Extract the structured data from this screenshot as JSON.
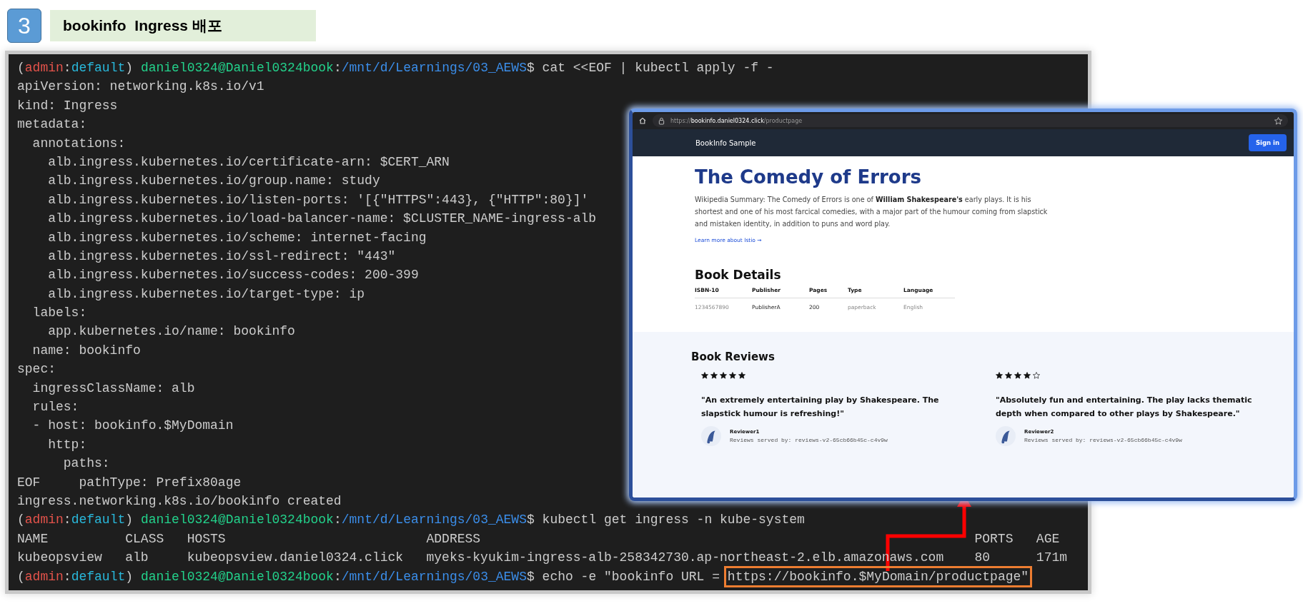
{
  "header": {
    "step": "3",
    "title": "bookinfo  Ingress 배포"
  },
  "terminal": {
    "lines": [
      {
        "kind": "segments",
        "segments": [
          {
            "text": "(",
            "color": "#cccccc"
          },
          {
            "text": "admin",
            "color": "#e5534b"
          },
          {
            "text": ":",
            "color": "#cccccc"
          },
          {
            "text": "default",
            "color": "#29b8db"
          },
          {
            "text": ") ",
            "color": "#cccccc"
          },
          {
            "text": "daniel0324@Daniel0324book",
            "color": "#23d18b"
          },
          {
            "text": ":",
            "color": "#cccccc"
          },
          {
            "text": "/mnt/d/Learnings/03_AEWS",
            "color": "#3b8eea"
          },
          {
            "text": "$ cat <<EOF | kubectl apply -f -",
            "color": "#cccccc"
          }
        ]
      },
      {
        "kind": "text",
        "text": "apiVersion: networking.k8s.io/v1"
      },
      {
        "kind": "text",
        "text": "kind: Ingress"
      },
      {
        "kind": "text",
        "text": "metadata:"
      },
      {
        "kind": "text",
        "text": "  annotations:"
      },
      {
        "kind": "text",
        "text": "    alb.ingress.kubernetes.io/certificate-arn: $CERT_ARN"
      },
      {
        "kind": "text",
        "text": "    alb.ingress.kubernetes.io/group.name: study"
      },
      {
        "kind": "text",
        "text": "    alb.ingress.kubernetes.io/listen-ports: '[{\"HTTPS\":443}, {\"HTTP\":80}]'"
      },
      {
        "kind": "text",
        "text": "    alb.ingress.kubernetes.io/load-balancer-name: $CLUSTER_NAME-ingress-alb"
      },
      {
        "kind": "text",
        "text": "    alb.ingress.kubernetes.io/scheme: internet-facing"
      },
      {
        "kind": "text",
        "text": "    alb.ingress.kubernetes.io/ssl-redirect: \"443\""
      },
      {
        "kind": "text",
        "text": "    alb.ingress.kubernetes.io/success-codes: 200-399"
      },
      {
        "kind": "text",
        "text": "    alb.ingress.kubernetes.io/target-type: ip"
      },
      {
        "kind": "text",
        "text": "  labels:"
      },
      {
        "kind": "text",
        "text": "    app.kubernetes.io/name: bookinfo"
      },
      {
        "kind": "text",
        "text": "  name: bookinfo"
      },
      {
        "kind": "text",
        "text": "spec:"
      },
      {
        "kind": "text",
        "text": "  ingressClassName: alb"
      },
      {
        "kind": "text",
        "text": "  rules:"
      },
      {
        "kind": "text",
        "text": "  - host: bookinfo.$MyDomain"
      },
      {
        "kind": "text",
        "text": "    http:"
      },
      {
        "kind": "text",
        "text": "      paths:"
      },
      {
        "kind": "text",
        "text": "EOF     pathType: Prefix80age"
      },
      {
        "kind": "text",
        "text": "ingress.networking.k8s.io/bookinfo created"
      },
      {
        "kind": "segments",
        "segments": [
          {
            "text": "(",
            "color": "#cccccc"
          },
          {
            "text": "admin",
            "color": "#e5534b"
          },
          {
            "text": ":",
            "color": "#cccccc"
          },
          {
            "text": "default",
            "color": "#29b8db"
          },
          {
            "text": ") ",
            "color": "#cccccc"
          },
          {
            "text": "daniel0324@Daniel0324book",
            "color": "#23d18b"
          },
          {
            "text": ":",
            "color": "#cccccc"
          },
          {
            "text": "/mnt/d/Learnings/03_AEWS",
            "color": "#3b8eea"
          },
          {
            "text": "$ kubectl get ingress -n kube-system",
            "color": "#cccccc"
          }
        ]
      },
      {
        "kind": "text",
        "text": "NAME          CLASS   HOSTS                          ADDRESS                                                                PORTS   AGE"
      },
      {
        "kind": "text",
        "text": "kubeopsview   alb     kubeopsview.daniel0324.click   myeks-kyukim-ingress-alb-258342730.ap-northeast-2.elb.amazonaws.com    80      171m"
      },
      {
        "kind": "segments",
        "segments": [
          {
            "text": "(",
            "color": "#cccccc"
          },
          {
            "text": "admin",
            "color": "#e5534b"
          },
          {
            "text": ":",
            "color": "#cccccc"
          },
          {
            "text": "default",
            "color": "#29b8db"
          },
          {
            "text": ") ",
            "color": "#cccccc"
          },
          {
            "text": "daniel0324@Daniel0324book",
            "color": "#23d18b"
          },
          {
            "text": ":",
            "color": "#cccccc"
          },
          {
            "text": "/mnt/d/Learnings/03_AEWS",
            "color": "#3b8eea"
          },
          {
            "text": "$ echo -e \"bookinfo URL = ",
            "color": "#cccccc"
          },
          {
            "text": "https://bookinfo.$MyDomain/productpage\"",
            "color": "#cccccc",
            "boxed": true
          }
        ]
      }
    ]
  },
  "browser": {
    "url": "https://**bookinfo.daniel0324.click**/productpage",
    "brand": "BookInfo Sample",
    "sign_in": "Sign in",
    "title": "The Comedy of Errors",
    "summary": "Wikipedia Summary: The Comedy of Errors is one of **William Shakespeare's** early plays. It is his shortest and one of his most farcical comedies, with a major part of the humour coming from slapstick and mistaken identity, in addition to puns and word play.",
    "link": "Learn more about Istio →",
    "details_title": "Book Details",
    "table": {
      "columns": [
        "ISBN-10",
        "Publisher",
        "Pages",
        "Type",
        "Language"
      ],
      "rows": [
        [
          "1234567890",
          "PublisherA",
          "200",
          "paperback",
          "English"
        ]
      ]
    },
    "reviews_title": "Book Reviews",
    "reviews": [
      {
        "stars": 5,
        "text": "\"An extremely entertaining play by Shakespeare. The slapstick humour is refreshing!\"",
        "reviewer": "Reviewer1",
        "served_by": "Reviews served by: reviews-v2-65cb66b45c-c4v9w"
      },
      {
        "stars": 4,
        "text": "\"Absolutely fun and entertaining. The play lacks thematic depth when compared to other plays by Shakespeare.\"",
        "reviewer": "Reviewer2",
        "served_by": "Reviews served by: reviews-v2-65cb66b45c-c4v9w"
      }
    ]
  }
}
